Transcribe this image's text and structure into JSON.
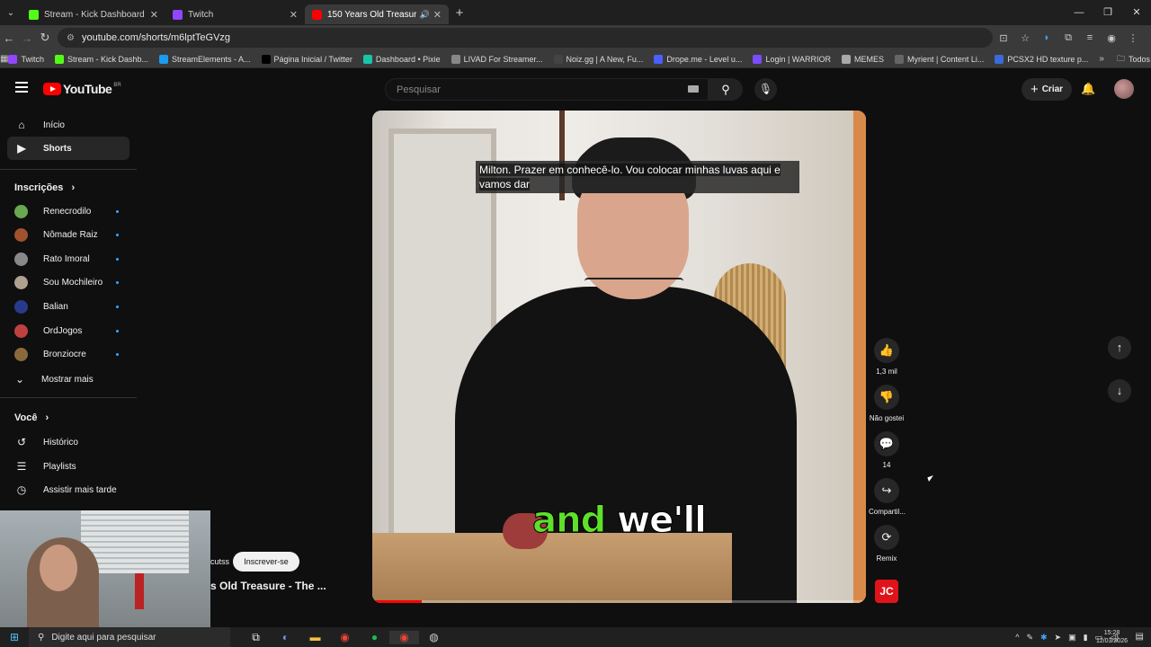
{
  "browser": {
    "tabs": [
      {
        "title": "Stream - Kick Dashboard",
        "color": "#53fc18",
        "active": false
      },
      {
        "title": "Twitch",
        "color": "#9146ff",
        "active": false
      },
      {
        "title": "150 Years Old Treasure - Th",
        "color": "#ff0000",
        "active": true
      }
    ],
    "url": "youtube.com/shorts/m6lptTeGVzg",
    "bookmarks": [
      {
        "label": "Twitch",
        "color": "#9146ff"
      },
      {
        "label": "Stream - Kick Dashb...",
        "color": "#53fc18"
      },
      {
        "label": "StreamElements - A...",
        "color": "#1d9bf0"
      },
      {
        "label": "Página Inicial / Twitter",
        "color": "#000000"
      },
      {
        "label": "Dashboard • Pixie",
        "color": "#18c5a8"
      },
      {
        "label": "LIVAD For Streamer...",
        "color": "#888888"
      },
      {
        "label": "Noiz.gg | A New, Fu...",
        "color": "#444444"
      },
      {
        "label": "Drope.me - Level u...",
        "color": "#4a60ff"
      },
      {
        "label": "Login | WARRIOR",
        "color": "#7a4dff"
      },
      {
        "label": "MEMES",
        "color": "#aaaaaa"
      },
      {
        "label": "Myrient | Content Li...",
        "color": "#666666"
      },
      {
        "label": "PCSX2 HD texture p...",
        "color": "#3b6bd8"
      }
    ],
    "all_favorites": "Todos os favoritos"
  },
  "youtube": {
    "logo_text": "YouTube",
    "country_code": "BR",
    "search_placeholder": "Pesquisar",
    "create_label": "Criar",
    "sidebar": {
      "main": [
        {
          "label": "Início",
          "icon": "home-icon",
          "active": false
        },
        {
          "label": "Shorts",
          "icon": "shorts-icon",
          "active": true
        }
      ],
      "subscriptions_title": "Inscrições",
      "subscriptions": [
        {
          "label": "Renecrodilo",
          "color": "#6aa84f"
        },
        {
          "label": "Nômade Raiz",
          "color": "#a0522d"
        },
        {
          "label": "Rato Imoral",
          "color": "#888888"
        },
        {
          "label": "Sou Mochileiro",
          "color": "#b0a090"
        },
        {
          "label": "Balian",
          "color": "#2a3a8a"
        },
        {
          "label": "OrdJogos",
          "color": "#c04040"
        },
        {
          "label": "Bronziocre",
          "color": "#8a6a3a"
        }
      ],
      "show_more": "Mostrar mais",
      "you_title": "Você",
      "you": [
        {
          "label": "Histórico",
          "icon": "history-icon"
        },
        {
          "label": "Playlists",
          "icon": "playlists-icon"
        },
        {
          "label": "Assistir mais tarde",
          "icon": "watch-later-icon"
        }
      ]
    },
    "video": {
      "caption": "Milton.  Prazer em conhecê-lo.  Vou colocar minhas luvas aqui e vamos dar",
      "burned_sub_green": "and",
      "burned_sub_white": "we'll",
      "progress": 0.1
    },
    "actions": [
      {
        "label": "1,3 mil",
        "icon": "like-icon"
      },
      {
        "label": "Não gostei",
        "icon": "dislike-icon"
      },
      {
        "label": "14",
        "icon": "comments-icon"
      },
      {
        "label": "Compartil...",
        "icon": "share-icon"
      },
      {
        "label": "Remix",
        "icon": "remix-icon"
      }
    ],
    "channel_logo": "JC",
    "channel_name_fragment": "cutss",
    "subscribe_label": "Inscrever-se",
    "video_title_fragment": "s Old Treasure - The ..."
  },
  "taskbar": {
    "search_placeholder": "Digite aqui para pesquisar",
    "time": "15:28",
    "date": "12/03/2026"
  }
}
